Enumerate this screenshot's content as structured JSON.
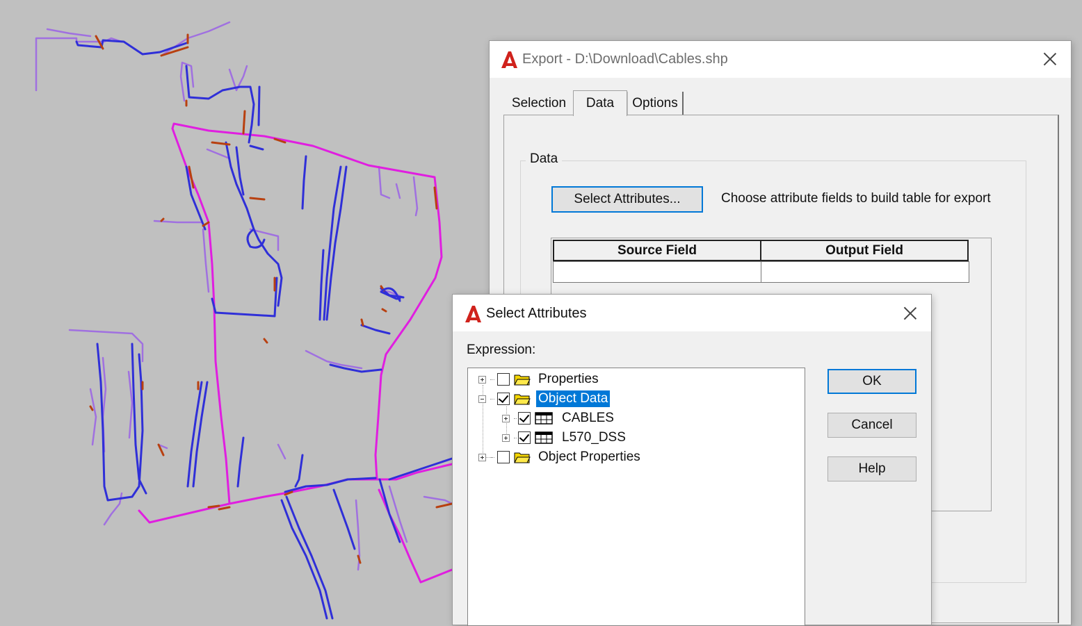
{
  "colors": {
    "background": "#c0c0c0",
    "cable_primary": "#2f2fd8",
    "cable_secondary": "#e01ee0",
    "cable_service": "#a070e0",
    "cable_stub": "#b84010",
    "selection": "#0078d7"
  },
  "map": {
    "content": "CAD drawing of cable network (blue, magenta, purple polylines with red stubs)"
  },
  "export_dialog": {
    "title": "Export - D:\\Download\\Cables.shp",
    "icon": "autocad-logo-icon",
    "close_icon": "close-icon",
    "tabs": [
      {
        "label": "Selection",
        "active": false
      },
      {
        "label": "Data",
        "active": true
      },
      {
        "label": "Options",
        "active": false
      }
    ],
    "group_label": "Data",
    "select_attributes_button": "Select Attributes...",
    "hint": "Choose attribute fields to build table for export",
    "table": {
      "columns": [
        "Source Field",
        "Output Field"
      ],
      "rows": [
        [
          "",
          ""
        ]
      ]
    }
  },
  "select_dialog": {
    "title": "Select Attributes",
    "icon": "autocad-logo-icon",
    "close_icon": "close-icon",
    "expression_label": "Expression:",
    "tree": [
      {
        "label": "Properties",
        "checked": false,
        "expanded": false,
        "icon": "folder-icon",
        "level": 0,
        "selected": false
      },
      {
        "label": "Object Data",
        "checked": true,
        "expanded": true,
        "icon": "folder-icon",
        "level": 0,
        "selected": true
      },
      {
        "label": "CABLES",
        "checked": true,
        "expanded": false,
        "icon": "table-icon",
        "level": 1,
        "selected": false
      },
      {
        "label": "L570_DSS",
        "checked": true,
        "expanded": false,
        "icon": "table-icon",
        "level": 1,
        "selected": false
      },
      {
        "label": "Object Properties",
        "checked": false,
        "expanded": false,
        "icon": "folder-icon",
        "level": 0,
        "selected": false
      }
    ],
    "buttons": {
      "ok": "OK",
      "cancel": "Cancel",
      "help": "Help"
    }
  }
}
